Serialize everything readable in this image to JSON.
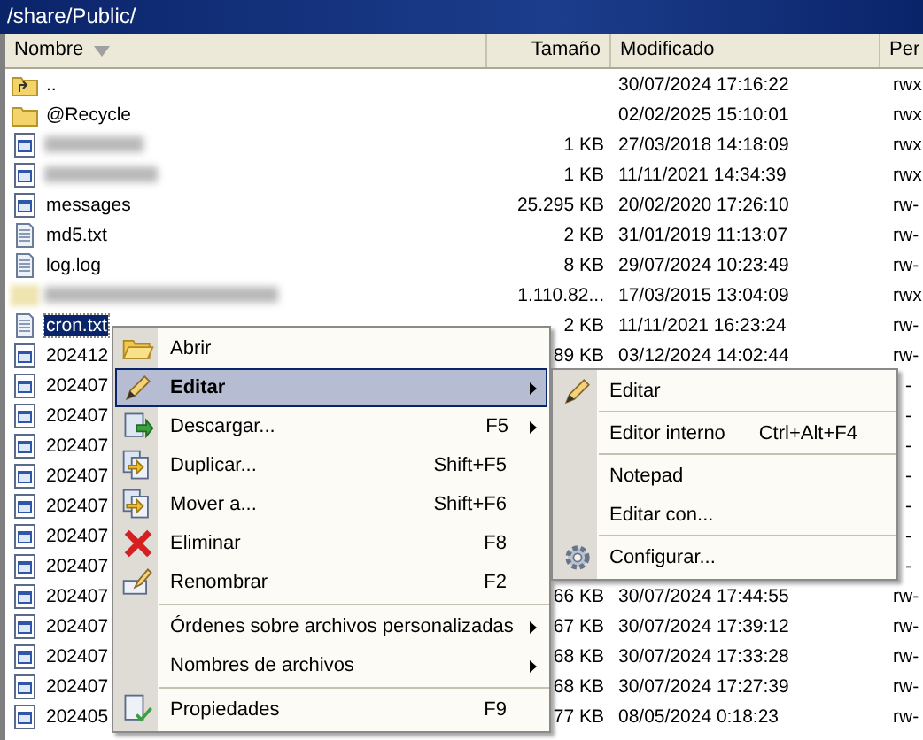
{
  "window": {
    "title": "/share/Public/"
  },
  "table": {
    "columns": [
      {
        "label": "Nombre",
        "sorted": true
      },
      {
        "label": "Tamaño",
        "sorted": false
      },
      {
        "label": "Modificado",
        "sorted": false
      },
      {
        "label": "Per",
        "sorted": false
      }
    ],
    "rows": [
      {
        "kind": "parent",
        "name": "..",
        "modified": "30/07/2024 17:16:22",
        "perm": "rwx",
        "selected": false
      },
      {
        "kind": "folder",
        "name": "@Recycle",
        "modified": "02/02/2025 15:10:01",
        "perm": "rwx",
        "selected": false
      },
      {
        "kind": "program",
        "redacted": true,
        "size": "1 KB",
        "modified": "27/03/2018 14:18:09",
        "perm": "rwx",
        "selected": false
      },
      {
        "kind": "program",
        "redacted": true,
        "size": "1 KB",
        "modified": "11/11/2021 14:34:39",
        "perm": "rwx",
        "selected": false
      },
      {
        "kind": "program",
        "name": "messages",
        "size": "25.295 KB",
        "modified": "20/02/2020 17:26:10",
        "perm": "rw-",
        "selected": false
      },
      {
        "kind": "text",
        "name": "md5.txt",
        "size": "2 KB",
        "modified": "31/01/2019 11:13:07",
        "perm": "rw-",
        "selected": false
      },
      {
        "kind": "text",
        "name": "log.log",
        "size": "8 KB",
        "modified": "29/07/2024 10:23:49",
        "perm": "rw-",
        "selected": false
      },
      {
        "kind": "folder",
        "redacted": true,
        "size": "1.110.82...",
        "modified": "17/03/2015 13:04:09",
        "perm": "rwx",
        "selected": false
      },
      {
        "kind": "text",
        "name": "cron.txt",
        "size": "2 KB",
        "modified": "11/11/2021 16:23:24",
        "perm": "rw-",
        "selected": true
      },
      {
        "kind": "program",
        "name": "202412",
        "size": "89 KB",
        "modified": "03/12/2024 14:02:44",
        "perm": "rw-",
        "selected": false
      },
      {
        "kind": "program",
        "name": "202407",
        "perm": "-",
        "selected": false
      },
      {
        "kind": "program",
        "name": "202407",
        "perm": "-",
        "selected": false
      },
      {
        "kind": "program",
        "name": "202407",
        "perm": "-",
        "selected": false
      },
      {
        "kind": "program",
        "name": "202407",
        "perm": "-",
        "selected": false
      },
      {
        "kind": "program",
        "name": "202407",
        "perm": "-",
        "selected": false
      },
      {
        "kind": "program",
        "name": "202407",
        "perm": "-",
        "selected": false
      },
      {
        "kind": "program",
        "name": "202407",
        "perm": "-",
        "selected": false
      },
      {
        "kind": "program",
        "name": "202407",
        "size": "66 KB",
        "modified": "30/07/2024 17:44:55",
        "perm": "rw-",
        "selected": false
      },
      {
        "kind": "program",
        "name": "202407",
        "size": "67 KB",
        "modified": "30/07/2024 17:39:12",
        "perm": "rw-",
        "selected": false
      },
      {
        "kind": "program",
        "name": "202407",
        "size": "68 KB",
        "modified": "30/07/2024 17:33:28",
        "perm": "rw-",
        "selected": false
      },
      {
        "kind": "program",
        "name": "202407",
        "size": "68 KB",
        "modified": "30/07/2024 17:27:39",
        "perm": "rw-",
        "selected": false
      },
      {
        "kind": "program",
        "name": "202405",
        "size": "77 KB",
        "modified": "08/05/2024 0:18:23",
        "perm": "rw-",
        "selected": false
      }
    ]
  },
  "context_menu": {
    "items": [
      {
        "kind": "item",
        "label": "Abrir",
        "default": false,
        "selected": false,
        "submenu": false
      },
      {
        "kind": "item",
        "label": "Editar",
        "default": true,
        "selected": true,
        "submenu": true
      },
      {
        "kind": "item",
        "label": "Descargar...",
        "shortcut": "F5",
        "default": false,
        "selected": false,
        "submenu": true
      },
      {
        "kind": "item",
        "label": "Duplicar...",
        "shortcut": "Shift+F5",
        "default": false,
        "selected": false,
        "submenu": false
      },
      {
        "kind": "item",
        "label": "Mover a...",
        "shortcut": "Shift+F6",
        "default": false,
        "selected": false,
        "submenu": false
      },
      {
        "kind": "item",
        "label": "Eliminar",
        "shortcut": "F8",
        "default": false,
        "selected": false,
        "submenu": false
      },
      {
        "kind": "item",
        "label": "Renombrar",
        "shortcut": "F2",
        "default": false,
        "selected": false,
        "submenu": false
      },
      {
        "kind": "separator"
      },
      {
        "kind": "item",
        "label": "Órdenes sobre archivos personalizadas",
        "default": false,
        "selected": false,
        "submenu": true
      },
      {
        "kind": "item",
        "label": "Nombres de archivos",
        "default": false,
        "selected": false,
        "submenu": true
      },
      {
        "kind": "separator"
      },
      {
        "kind": "item",
        "label": "Propiedades",
        "shortcut": "F9",
        "default": false,
        "selected": false,
        "submenu": false
      }
    ]
  },
  "submenu": {
    "items": [
      {
        "kind": "item",
        "label": "Editar",
        "selected": false
      },
      {
        "kind": "separator"
      },
      {
        "kind": "item",
        "label": "Editor interno",
        "shortcut": "Ctrl+Alt+F4",
        "selected": false
      },
      {
        "kind": "separator"
      },
      {
        "kind": "item",
        "label": "Notepad",
        "selected": false
      },
      {
        "kind": "item",
        "label": "Editar con...",
        "selected": false
      },
      {
        "kind": "separator"
      },
      {
        "kind": "item",
        "label": "Configurar...",
        "selected": false
      }
    ]
  }
}
